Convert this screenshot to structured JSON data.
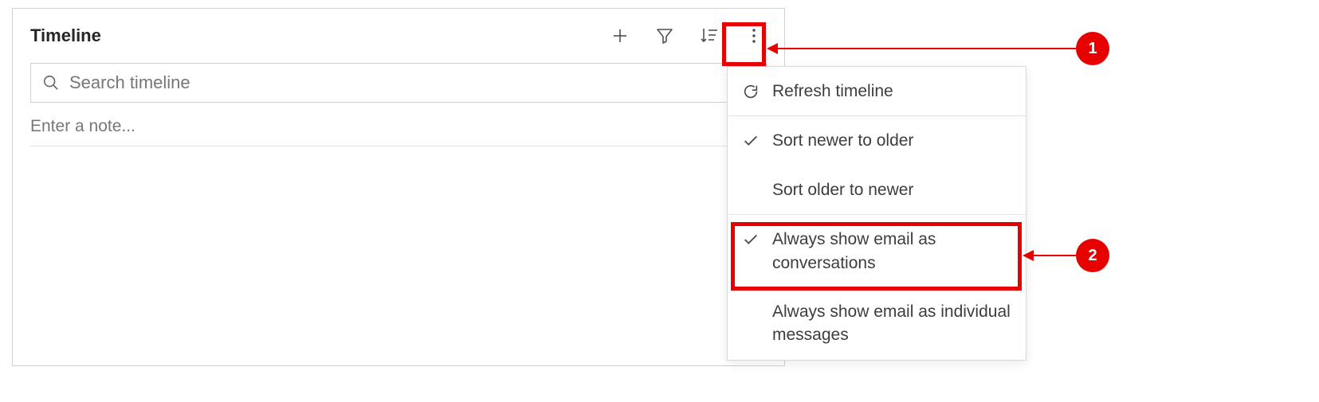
{
  "panel": {
    "title": "Timeline",
    "search_placeholder": "Search timeline",
    "note_placeholder": "Enter a note..."
  },
  "toolbar": {
    "add_label": "Add",
    "filter_label": "Filter",
    "sort_label": "Sort",
    "more_label": "More commands"
  },
  "menu": {
    "refresh": "Refresh timeline",
    "sort_newer": "Sort newer to older",
    "sort_older": "Sort older to newer",
    "email_conversations": "Always show email as conversations",
    "email_individual": "Always show email as individual messages"
  },
  "callouts": {
    "one": "1",
    "two": "2"
  }
}
